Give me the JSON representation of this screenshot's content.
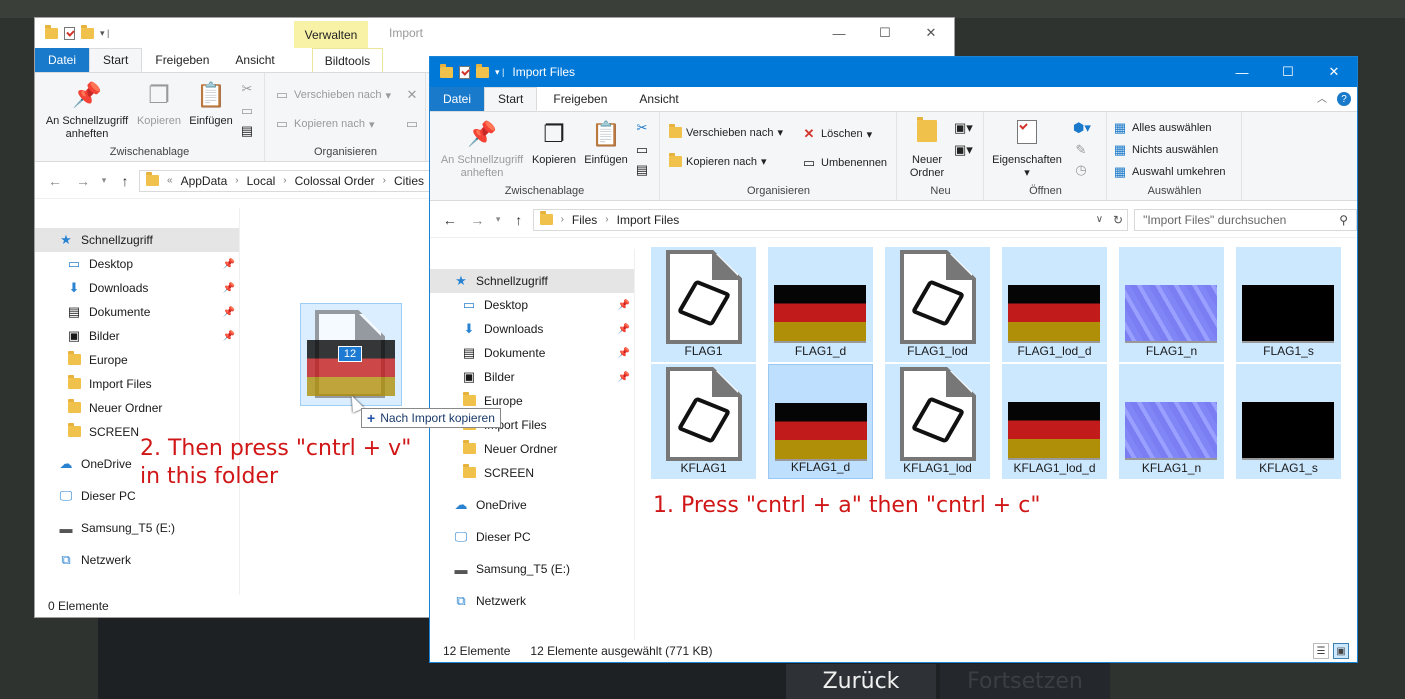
{
  "colors": {
    "accent": "#0078d7",
    "annotation": "#d01616",
    "selection": "#cce8ff"
  },
  "back_window": {
    "title": "Import",
    "context_tab": "Verwalten",
    "tabs": [
      "Datei",
      "Start",
      "Freigeben",
      "Ansicht",
      "Bildtools"
    ],
    "ribbon": {
      "pin_label": "An Schnellzugriff anheften",
      "copy_label": "Kopieren",
      "paste_label": "Einfügen",
      "group1": "Zwischenablage",
      "move_label": "Verschieben nach",
      "copyto_label": "Kopieren nach",
      "group2": "Organisieren"
    },
    "breadcrumb": [
      "AppData",
      "Local",
      "Colossal Order",
      "Cities"
    ],
    "nav": [
      {
        "label": "Schnellzugriff",
        "icon": "star-icon"
      },
      {
        "label": "Desktop",
        "icon": "desktop-icon"
      },
      {
        "label": "Downloads",
        "icon": "download-icon"
      },
      {
        "label": "Dokumente",
        "icon": "document-icon"
      },
      {
        "label": "Bilder",
        "icon": "pictures-icon"
      },
      {
        "label": "Europe",
        "icon": "folder-icon"
      },
      {
        "label": "Import Files",
        "icon": "folder-icon"
      },
      {
        "label": "Neuer Ordner",
        "icon": "folder-icon"
      },
      {
        "label": "SCREEN",
        "icon": "folder-icon"
      },
      {
        "label": "OneDrive",
        "icon": "cloud-icon"
      },
      {
        "label": "Dieser PC",
        "icon": "computer-icon"
      },
      {
        "label": "Samsung_T5 (E:)",
        "icon": "drive-icon"
      },
      {
        "label": "Netzwerk",
        "icon": "network-icon"
      }
    ],
    "status": "0 Elemente"
  },
  "front_window": {
    "title": "Import Files",
    "tabs": [
      "Datei",
      "Start",
      "Freigeben",
      "Ansicht"
    ],
    "ribbon": {
      "pin_label": "An Schnellzugriff anheften",
      "copy_label": "Kopieren",
      "paste_label": "Einfügen",
      "group1": "Zwischenablage",
      "move_label": "Verschieben nach",
      "copyto_label": "Kopieren nach",
      "delete_label": "Löschen",
      "rename_label": "Umbenennen",
      "group2": "Organisieren",
      "newfolder_label": "Neuer Ordner",
      "group3": "Neu",
      "properties_label": "Eigenschaften",
      "group4": "Öffnen",
      "selectall_label": "Alles auswählen",
      "selectnone_label": "Nichts auswählen",
      "invert_label": "Auswahl umkehren",
      "group5": "Auswählen"
    },
    "breadcrumb": [
      "Files",
      "Import Files"
    ],
    "search_placeholder": "\"Import Files\" durchsuchen",
    "nav": [
      {
        "label": "Schnellzugriff"
      },
      {
        "label": "Desktop"
      },
      {
        "label": "Downloads"
      },
      {
        "label": "Dokumente"
      },
      {
        "label": "Bilder"
      },
      {
        "label": "Europe"
      },
      {
        "label": "Import Files"
      },
      {
        "label": "Neuer Ordner"
      },
      {
        "label": "SCREEN"
      },
      {
        "label": "OneDrive"
      },
      {
        "label": "Dieser PC"
      },
      {
        "label": "Samsung_T5 (E:)"
      },
      {
        "label": "Netzwerk"
      }
    ],
    "files": [
      {
        "name": "FLAG1",
        "kind": "model"
      },
      {
        "name": "FLAG1_d",
        "kind": "flag"
      },
      {
        "name": "FLAG1_lod",
        "kind": "model"
      },
      {
        "name": "FLAG1_lod_d",
        "kind": "flag"
      },
      {
        "name": "FLAG1_n",
        "kind": "normal"
      },
      {
        "name": "FLAG1_s",
        "kind": "black"
      },
      {
        "name": "KFLAG1",
        "kind": "model"
      },
      {
        "name": "KFLAG1_d",
        "kind": "flag"
      },
      {
        "name": "KFLAG1_lod",
        "kind": "model"
      },
      {
        "name": "KFLAG1_lod_d",
        "kind": "flag"
      },
      {
        "name": "KFLAG1_n",
        "kind": "normal"
      },
      {
        "name": "KFLAG1_s",
        "kind": "black"
      }
    ],
    "status_count": "12 Elemente",
    "status_selected": "12 Elemente ausgewählt (771 KB)"
  },
  "drag": {
    "count": "12",
    "tooltip": "Nach Import kopieren"
  },
  "annotations": {
    "step1": "1. Press \"cntrl + a\" then \"cntrl + c\"",
    "step2_line1": "2. Then press \"cntrl + v\"",
    "step2_line2": "in this folder"
  },
  "game": {
    "back_label": "Zurück",
    "continue_label": "Fortsetzen"
  }
}
